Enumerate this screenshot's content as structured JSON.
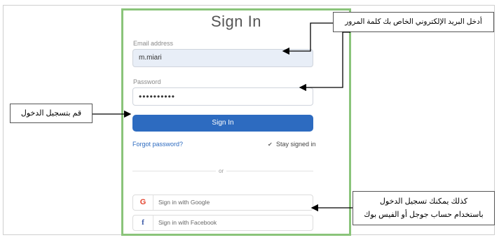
{
  "form": {
    "title": "Sign In",
    "email_label": "Email address",
    "email_value": "m.miari",
    "password_label": "Password",
    "password_value": "••••••••••",
    "signin_label": "Sign In",
    "forgot_label": "Forgot password?",
    "stay_label": "Stay signed in",
    "or_label": "or",
    "google_label": "Sign in with Google",
    "facebook_label": "Sign in with Facebook"
  },
  "annotations": {
    "email_password_note": "أدخل البريد الإلكتروني الخاص بك كلمة المرور",
    "signin_note": "قم بتسجيل الدخول",
    "social_note_line1": "كذلك يمكنك تسجيل الدخول",
    "social_note_line2": "باستخدام حساب جوجل أو الفيس بوك"
  },
  "colors": {
    "panel_border": "#8ac47a",
    "primary_button": "#2d6bc0",
    "email_field_bg": "#e8eef7"
  },
  "icons": [
    "google-icon",
    "facebook-icon",
    "checkbox-icon"
  ]
}
